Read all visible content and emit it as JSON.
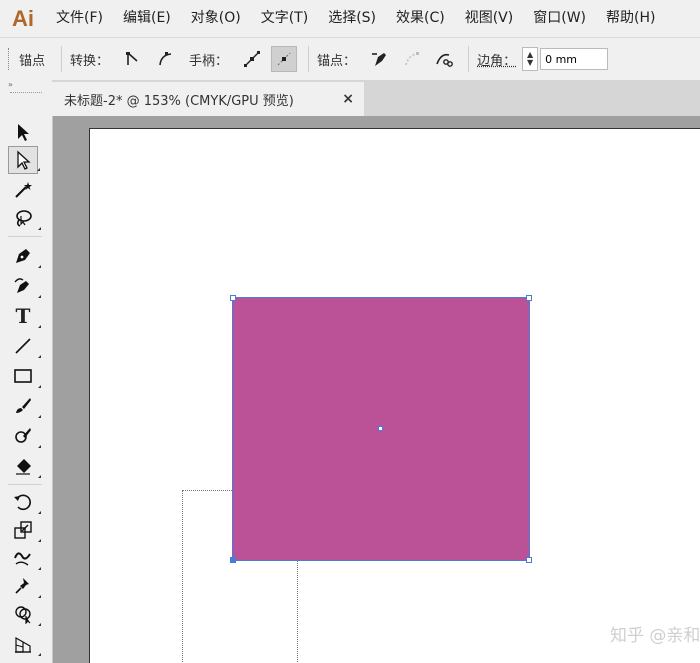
{
  "app": {
    "logo": "Ai"
  },
  "menu": [
    "文件(F)",
    "编辑(E)",
    "对象(O)",
    "文字(T)",
    "选择(S)",
    "效果(C)",
    "视图(V)",
    "窗口(W)",
    "帮助(H)"
  ],
  "control_bar": {
    "anchor_label": "锚点",
    "convert_label": "转换：",
    "handles_label": "手柄：",
    "anchor_points_label": "锚点：",
    "corner_label": "边角：",
    "corner_value": "0 mm"
  },
  "document_tab": {
    "title": "未标题-2* @ 153% (CMYK/GPU 预览)",
    "close_symbol": "×"
  },
  "toolbar": {
    "header_symbol": "»",
    "tools": [
      {
        "name": "selection-tool",
        "icon": "selection-arrow-icon"
      },
      {
        "name": "direct-selection-tool",
        "icon": "direct-selection-icon",
        "active": true
      },
      {
        "name": "magic-wand-tool",
        "icon": "magic-wand-icon"
      },
      {
        "name": "lasso-tool",
        "icon": "lasso-icon"
      },
      {
        "name": "pen-tool",
        "icon": "pen-icon"
      },
      {
        "name": "curvature-tool",
        "icon": "curvature-icon"
      },
      {
        "name": "type-tool",
        "icon": "type-icon",
        "glyph": "T"
      },
      {
        "name": "line-tool",
        "icon": "line-icon"
      },
      {
        "name": "rectangle-tool",
        "icon": "rectangle-icon"
      },
      {
        "name": "paintbrush-tool",
        "icon": "paintbrush-icon"
      },
      {
        "name": "shaper-tool",
        "icon": "shaper-icon"
      },
      {
        "name": "eraser-tool",
        "icon": "eraser-icon"
      },
      {
        "name": "rotate-tool",
        "icon": "rotate-icon"
      },
      {
        "name": "scale-tool",
        "icon": "scale-icon"
      },
      {
        "name": "warp-tool",
        "icon": "warp-icon"
      },
      {
        "name": "puppet-warp-tool",
        "icon": "pushpin-icon"
      },
      {
        "name": "shape-builder-tool",
        "icon": "shape-builder-icon"
      },
      {
        "name": "perspective-grid-tool",
        "icon": "perspective-grid-icon"
      }
    ]
  },
  "canvas": {
    "shape_fill": "#bb5196",
    "selection_color": "#4a7bd8",
    "watermark": "知乎 @亲和"
  }
}
